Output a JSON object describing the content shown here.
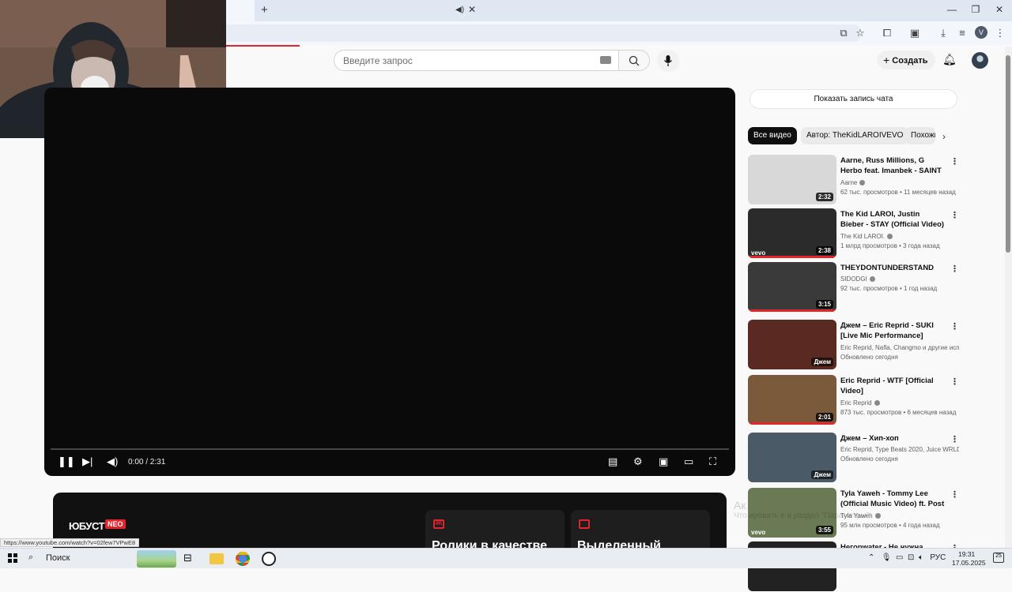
{
  "browser": {
    "new_tab": "+",
    "tab_close": "✕",
    "profile_letter": "V",
    "status_url": "https://www.youtube.com/watch?v=02few7VPwE8"
  },
  "header": {
    "search_placeholder": "Введите запрос",
    "create_label": "Создать"
  },
  "player": {
    "time": "0:00 / 2:31",
    "progress_fraction": 0.0
  },
  "promo": {
    "logo": "ЮБУСТ",
    "badge": "NEO",
    "cards": [
      {
        "icon": "4K",
        "text": "Ролики в качестве"
      },
      {
        "icon": "",
        "text": "Выделенный"
      }
    ]
  },
  "sidebar": {
    "chat_button": "Показать запись чата",
    "chips": [
      "Все видео",
      "Автор: TheKidLAROIVEVO",
      "Похожие"
    ],
    "items": [
      {
        "title": "Aarne, Russ Millions, G Herbo feat. Imanbek - SAINT",
        "channel": "Aarne",
        "verified": true,
        "meta": "62 тыс. просмотров  • 11 месяцев назад",
        "duration": "2:32",
        "thumb": "#d8d8d8",
        "vevo": false,
        "mix": false,
        "watched": false
      },
      {
        "title": "The Kid LAROI, Justin Bieber - STAY (Official Video)",
        "channel": "The Kid LAROI.",
        "verified": true,
        "meta": "1 млрд просмотров  • 3 года назад",
        "duration": "2:38",
        "thumb": "#2b2b2b",
        "vevo": true,
        "mix": false,
        "watched": true
      },
      {
        "title": "THEYDONTUNDERSTAND",
        "channel": "SIDODGI",
        "verified": true,
        "meta": "92 тыс. просмотров  • 1 год назад",
        "duration": "3:15",
        "thumb": "#3a3a3a",
        "vevo": false,
        "mix": false,
        "watched": true
      },
      {
        "title": "Джем – Eric Reprid - SUKI [Live Mic Performance]",
        "channel": "Eric Reprid, Nafla, Changmo и другие исполнители",
        "verified": false,
        "meta": "Обновлено сегодня",
        "duration": "Джем",
        "thumb": "#5a2a22",
        "vevo": false,
        "mix": true,
        "watched": false
      },
      {
        "title": "Eric Reprid - WTF [Official Video]",
        "channel": "Eric Reprid",
        "verified": true,
        "meta": "873 тыс. просмотров  • 6 месяцев назад",
        "duration": "2:01",
        "thumb": "#7a5a3a",
        "vevo": false,
        "mix": false,
        "watched": true
      },
      {
        "title": "Джем – Хип-хоп",
        "channel": "Eric Reprid, Type Beats 2020, Juice WRLD",
        "verified": false,
        "meta": "Обновлено сегодня",
        "duration": "Джем",
        "thumb": "#4a5a66",
        "vevo": false,
        "mix": true,
        "watched": false
      },
      {
        "title": "Tyla Yaweh - Tommy Lee (Official Music Video) ft. Post Malone",
        "channel": "Tyla Yaweh",
        "verified": true,
        "meta": "95 млн просмотров  • 4 года назад",
        "duration": "3:55",
        "thumb": "#6a7a55",
        "vevo": true,
        "mix": false,
        "watched": false
      },
      {
        "title": "Негорwater - Не нужна",
        "channel": "",
        "verified": false,
        "meta": "",
        "duration": "",
        "thumb": "#222",
        "vevo": false,
        "mix": false,
        "watched": false
      }
    ]
  },
  "watermark": {
    "line1": "Ак",
    "line2": "Что                   ировать          е в раздел \"Параметры\"."
  },
  "taskbar": {
    "search_label": "Поиск",
    "lang": "РУС",
    "time": "19:31",
    "date": "17.05.2025",
    "notif_count": "25"
  },
  "colors": {
    "accent": "#e3242b",
    "player_bg": "#0a0a0a"
  }
}
